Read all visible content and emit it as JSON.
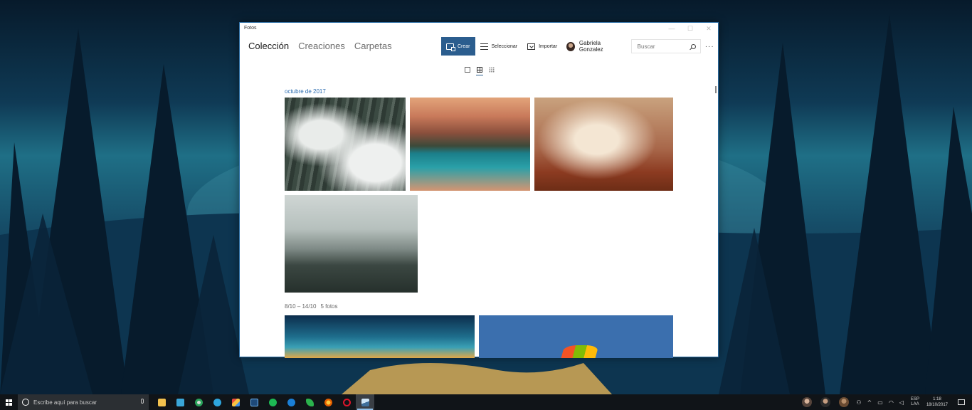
{
  "window": {
    "app_title": "Fotos",
    "controls": {
      "minimize": "—",
      "maximize": "☐",
      "close": "✕"
    }
  },
  "nav": {
    "tabs": [
      {
        "label": "Colección",
        "active": true
      },
      {
        "label": "Creaciones",
        "active": false
      },
      {
        "label": "Carpetas",
        "active": false
      }
    ]
  },
  "toolbar": {
    "crear_label": "Crear",
    "seleccionar_label": "Seleccionar",
    "importar_label": "Importar",
    "user_name": "Gabriela Gonzalez",
    "search_placeholder": "Buscar",
    "more_label": "···"
  },
  "view": {
    "selected": "medium"
  },
  "sections": [
    {
      "title": "octubre de 2017",
      "count": ""
    },
    {
      "title": "8/10 – 14/10",
      "count": "5 fotos"
    }
  ],
  "taskbar": {
    "search_placeholder": "Escribe aquí para buscar",
    "apps": [
      "file-explorer",
      "store",
      "chrome",
      "telegram",
      "paint",
      "photoshop-express",
      "spotify",
      "edge",
      "feedly",
      "firefox",
      "opera",
      "photos"
    ],
    "tray": {
      "language_top": "ESP",
      "language_bottom": "LAA",
      "time": "1:18",
      "date": "18/10/2017"
    }
  },
  "colors": {
    "accent": "#2b5d8e",
    "section_link": "#2b6cb0",
    "taskbar": "#101418"
  }
}
